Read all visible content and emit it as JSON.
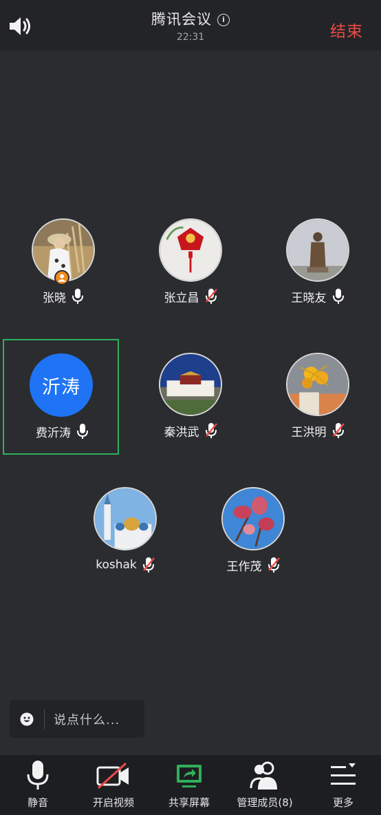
{
  "header": {
    "title": "腾讯会议",
    "time": "22:31",
    "end_label": "结束"
  },
  "participants": [
    {
      "name": "张晓",
      "mic": "on",
      "avatar": "photo",
      "host": true
    },
    {
      "name": "张立昌",
      "mic": "muted",
      "avatar": "photo"
    },
    {
      "name": "王晓友",
      "mic": "on",
      "avatar": "photo"
    },
    {
      "name": "费沂涛",
      "mic": "on",
      "avatar_text": "沂涛",
      "avatar_color": "#1e74f5",
      "selected": true
    },
    {
      "name": "秦洪武",
      "mic": "muted",
      "avatar": "photo"
    },
    {
      "name": "王洪明",
      "mic": "muted",
      "avatar": "photo"
    },
    {
      "name": "koshak",
      "mic": "muted",
      "avatar": "photo"
    },
    {
      "name": "王作茂",
      "mic": "muted",
      "avatar": "photo"
    }
  ],
  "chat": {
    "placeholder": "说点什么..."
  },
  "toolbar": [
    {
      "label": "静音",
      "icon": "microphone-icon"
    },
    {
      "label": "开启视频",
      "icon": "video-off-icon"
    },
    {
      "label": "共享屏幕",
      "icon": "share-screen-icon"
    },
    {
      "label": "管理成员(8)",
      "icon": "members-icon"
    },
    {
      "label": "更多",
      "icon": "more-menu-icon"
    }
  ],
  "colors": {
    "end": "#f04a45",
    "mic_on": "#ffffff",
    "mic_muted": "#f04a45",
    "share": "#2fb15a",
    "selected_border": "#2fb15a"
  }
}
